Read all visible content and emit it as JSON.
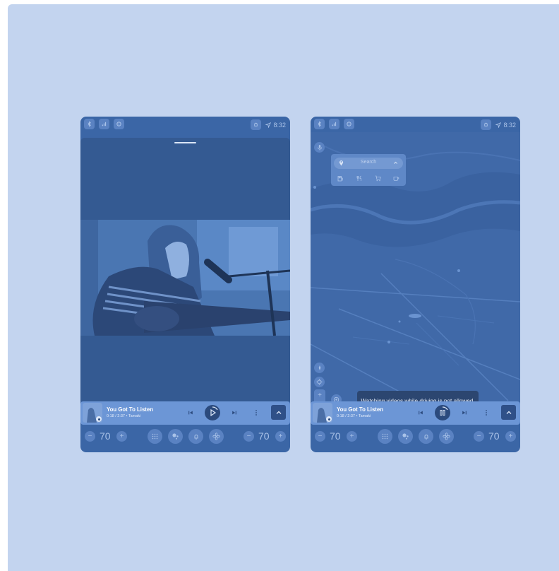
{
  "status_bar": {
    "time": "8:32"
  },
  "now_playing": {
    "title": "You Got To Listen",
    "subtitle": "0:18 / 2:37 • Tamaki"
  },
  "climate": {
    "left_temp": "70",
    "right_temp": "70",
    "decrease": "−",
    "increase": "+"
  },
  "map": {
    "search_placeholder": "Search",
    "zoom_in": "+",
    "zoom_out": "−",
    "toast": "Watching videos while driving is not allowed."
  },
  "colors": {
    "background": "#c3d4ef",
    "screen": "#3b66a6",
    "media_bar": "#6c96d6",
    "toast": "#2c4670"
  },
  "icons": [
    "bluetooth-icon",
    "signal-icon",
    "settings-icon",
    "bell-icon",
    "navigation-arrow-icon",
    "mic-icon",
    "pin-icon",
    "chevron-up-icon",
    "fuel-icon",
    "restaurant-icon",
    "cart-icon",
    "coffee-icon",
    "compass-icon",
    "locate-icon",
    "skip-previous-icon",
    "play-icon",
    "pause-icon",
    "skip-next-icon",
    "more-icon",
    "app-grid-icon",
    "assistant-icon",
    "fan-icon"
  ]
}
